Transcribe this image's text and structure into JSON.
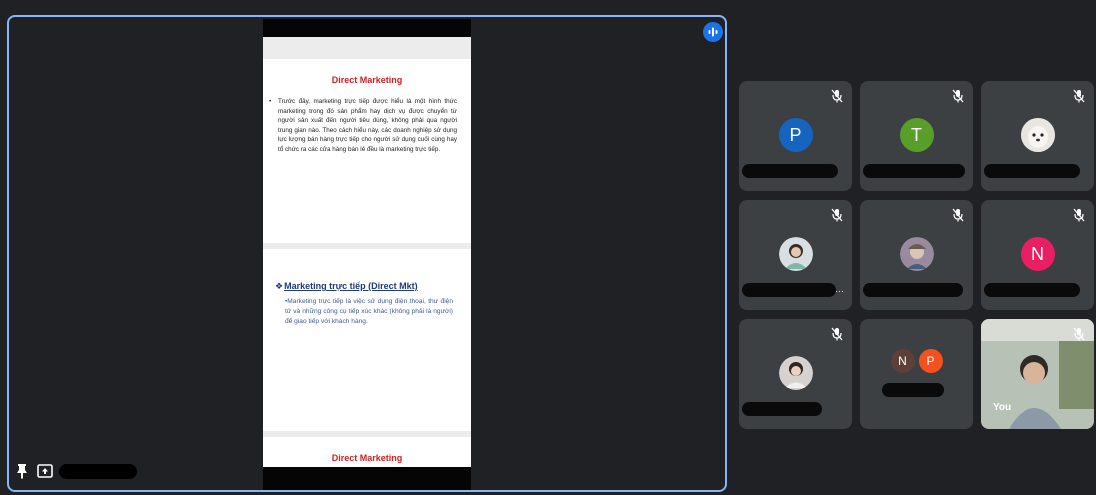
{
  "stage": {
    "slides": [
      {
        "title": "Direct Marketing",
        "bullet": "•",
        "body": "Trước đây, marketing trực tiếp được hiểu là một hình thức marketing trong đó sản phẩm hay dịch vụ được chuyển từ người sản xuất đến người tiêu dùng, không phải qua người trung gian nào. Theo cách hiểu này, các doanh nghiệp sử dụng lực lượng bán hàng trực tiếp cho người sử dụng cuối cùng hay tổ chức ra các cửa hàng bán lẻ đều là marketing trực tiếp."
      },
      {
        "title_symbol": "❖",
        "title": "Marketing trực tiếp (Direct Mkt)",
        "body": "•Marketing trực tiếp là việc sử dụng điện thoại, thư điện tử và những công cụ tiếp xúc khác (không phải là người) để giao tiếp với khách hàng."
      },
      {
        "title": "Direct Marketing"
      }
    ],
    "accent_color": "#8ab4f8"
  },
  "participants": [
    {
      "initial": "P",
      "color": "#1565c0"
    },
    {
      "initial": "T",
      "color": "#5a9e2a"
    },
    {
      "initial": "",
      "color": "#e8e8e8"
    },
    {
      "initial": "",
      "color": "#cfd8dc"
    },
    {
      "initial": "",
      "color": "#8d7b8e"
    },
    {
      "initial": "N",
      "color": "#e91e63"
    },
    {
      "initial": "",
      "color": "#e0e0e0"
    },
    {
      "initials": [
        "N",
        "P"
      ],
      "colors": [
        "#5d4037",
        "#f4511e"
      ]
    },
    {
      "label": "You"
    }
  ],
  "icons": {
    "mute": "mic-off-icon",
    "pin": "pin-icon",
    "present": "present-icon",
    "activity": "audio-activity-icon"
  }
}
